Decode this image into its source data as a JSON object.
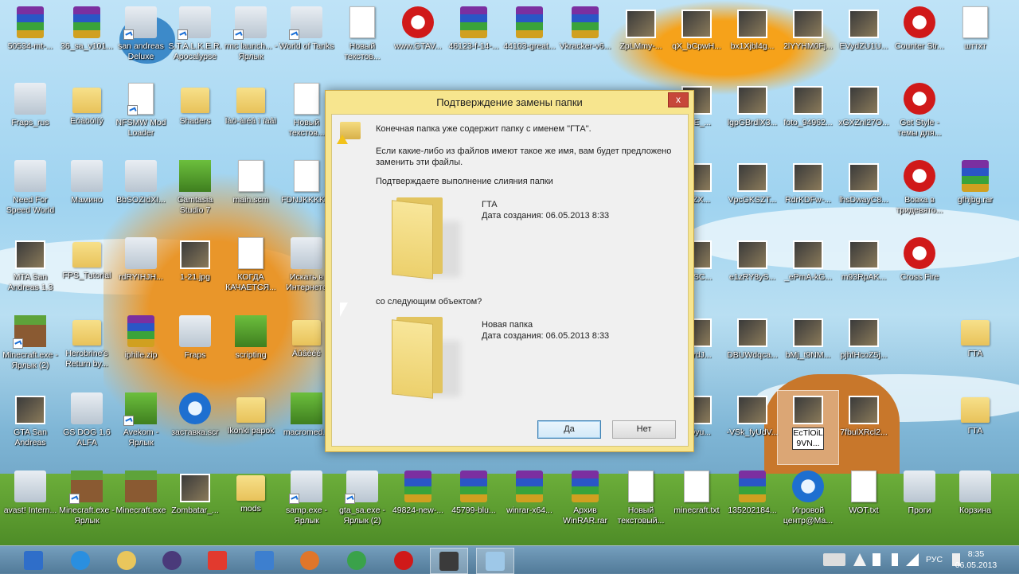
{
  "dialog": {
    "title": "Подтверждение замены папки",
    "close_label": "x",
    "line1": "Конечная папка уже содержит папку с именем \"ГТА\".",
    "line2": "Если какие-либо из файлов имеют такое же имя, вам будет предложено",
    "line3": "заменить эти файлы.",
    "question": "Подтверждаете выполнение слияния папки",
    "src_name": "ГТА",
    "src_date": "Дата создания: 06.05.2013 8:33",
    "with_label": "со следующим объектом?",
    "dst_name": "Новая папка",
    "dst_date": "Дата создания: 06.05.2013 8:33",
    "yes_label": "Да",
    "no_label": "Нет"
  },
  "desktop": {
    "icons": [
      {
        "label": "50534-mt-...",
        "kind": "rar"
      },
      {
        "label": "36_sa_v101...",
        "kind": "rar"
      },
      {
        "label": "san andreas Deluxe",
        "kind": "app"
      },
      {
        "label": "S.T.A.L.K.E.R. Apocalypse",
        "kind": "app"
      },
      {
        "label": "rmc launch... - Ярлык",
        "kind": "app"
      },
      {
        "label": "World of Tanks",
        "kind": "app"
      },
      {
        "label": "Новый текстов...",
        "kind": "doc"
      },
      {
        "label": "www.GTAV...",
        "kind": "red"
      },
      {
        "label": "46123-f-14-...",
        "kind": "rar"
      },
      {
        "label": "44103-great...",
        "kind": "rar"
      },
      {
        "label": "Vkracker-v6...",
        "kind": "rar"
      },
      {
        "label": "ZpLMmy-...",
        "kind": "photo"
      },
      {
        "label": "qX_bCpwH...",
        "kind": "photo"
      },
      {
        "label": "bx1Xjbl4g...",
        "kind": "photo"
      },
      {
        "label": "2lYYHM0Fj...",
        "kind": "photo"
      },
      {
        "label": "EVydZU1U...",
        "kind": "photo"
      },
      {
        "label": "Counter Str...",
        "kind": "red"
      },
      {
        "label": "шттхт",
        "kind": "doc"
      },
      {
        "label": "Fraps_rus",
        "kind": "app"
      },
      {
        "label": "Ëóàöóííý",
        "kind": "folder"
      },
      {
        "label": "NFSMW Mod Loader",
        "kind": "doc"
      },
      {
        "label": "Shaders",
        "kind": "folder"
      },
      {
        "label": "Ïàö-àïéâ ï ïàâì",
        "kind": "folder"
      },
      {
        "label": "Новый текстов...",
        "kind": "doc"
      },
      {
        "label": "МdE_...",
        "kind": "photo"
      },
      {
        "label": "lgpGBrdlX3...",
        "kind": "photo"
      },
      {
        "label": "foto_94962...",
        "kind": "photo"
      },
      {
        "label": "xGXZnl27O...",
        "kind": "photo"
      },
      {
        "label": "Get Style - темы для...",
        "kind": "red"
      },
      {
        "label": "Need For Speed World",
        "kind": "app"
      },
      {
        "label": "Мамино",
        "kind": "app"
      },
      {
        "label": "BbSOZIdXI...",
        "kind": "app"
      },
      {
        "label": "Camtasia Studio 7",
        "kind": "green"
      },
      {
        "label": "main.scm",
        "kind": "doc"
      },
      {
        "label": "FDNJKKKK...",
        "kind": "doc"
      },
      {
        "label": "FnZX...",
        "kind": "photo"
      },
      {
        "label": "VpcGKSZT...",
        "kind": "photo"
      },
      {
        "label": "RdrKDFw-...",
        "kind": "photo"
      },
      {
        "label": "lhsDwayC8...",
        "kind": "photo"
      },
      {
        "label": "Вовка в тридевято...",
        "kind": "red"
      },
      {
        "label": "gfhjbg.rar",
        "kind": "rar"
      },
      {
        "label": "MTA San Andreas 1.3",
        "kind": "photo"
      },
      {
        "label": "FPS_Tutorial",
        "kind": "folder"
      },
      {
        "label": "rdRYIHJH...",
        "kind": "app"
      },
      {
        "label": "1-21.jpg",
        "kind": "photo"
      },
      {
        "label": "КОГДА КАЧАЕТСЯ...",
        "kind": "doc"
      },
      {
        "label": "Искать в Интернете",
        "kind": "app"
      },
      {
        "label": "23-SC...",
        "kind": "photo"
      },
      {
        "label": "e1zRY8yS...",
        "kind": "photo"
      },
      {
        "label": "_ePmA-kG...",
        "kind": "photo"
      },
      {
        "label": "m93RpAK...",
        "kind": "photo"
      },
      {
        "label": "Cross Fire",
        "kind": "red"
      },
      {
        "label": "Minecraft.exe - Ярлык (2)",
        "kind": "mine"
      },
      {
        "label": "Herobrine's Return by...",
        "kind": "folder"
      },
      {
        "label": "iphile.zip",
        "kind": "rar"
      },
      {
        "label": "Fraps",
        "kind": "app"
      },
      {
        "label": "scripting",
        "kind": "green"
      },
      {
        "label": "Áûâèéé",
        "kind": "folder"
      },
      {
        "label": "BArdJ...",
        "kind": "photo"
      },
      {
        "label": "DBUWdqca...",
        "kind": "photo"
      },
      {
        "label": "bMj_t9NM...",
        "kind": "photo"
      },
      {
        "label": "pjhfHcoZ5j...",
        "kind": "photo"
      },
      {
        "label": "ГТА",
        "kind": "folder"
      },
      {
        "label": "GTA San Andreas",
        "kind": "photo"
      },
      {
        "label": "GS DOG 1.6 ALFA",
        "kind": "app"
      },
      {
        "label": "Avekom - Ярлык",
        "kind": "green"
      },
      {
        "label": "заставка.scr",
        "kind": "blue"
      },
      {
        "label": "Ikonki papok",
        "kind": "folder"
      },
      {
        "label": "macromed...",
        "kind": "green"
      },
      {
        "label": "OOyu...",
        "kind": "photo"
      },
      {
        "label": "-VSk_fyUdV...",
        "kind": "photo"
      },
      {
        "label": "EcTlOiL9VN...",
        "kind": "photo"
      },
      {
        "label": "7fbulXRcl2...",
        "kind": "photo"
      },
      {
        "label": "ГТА",
        "kind": "folder"
      },
      {
        "label": "avast! Intern...",
        "kind": "app"
      },
      {
        "label": "Minecraft.exe - Ярлык",
        "kind": "mine"
      },
      {
        "label": "Minecraft.exe",
        "kind": "mine"
      },
      {
        "label": "Zombatar_...",
        "kind": "photo"
      },
      {
        "label": "mods",
        "kind": "folder"
      },
      {
        "label": "samp.exe - Ярлык",
        "kind": "app"
      },
      {
        "label": "gta_sa.exe - Ярлык (2)",
        "kind": "app"
      },
      {
        "label": "49824-new-...",
        "kind": "rar"
      },
      {
        "label": "45799-blu...",
        "kind": "rar"
      },
      {
        "label": "winrar-x64...",
        "kind": "rar"
      },
      {
        "label": "Архив WinRAR.rar",
        "kind": "rar"
      },
      {
        "label": "Новый текстовый...",
        "kind": "doc"
      },
      {
        "label": "minecraft.txt",
        "kind": "doc"
      },
      {
        "label": "135202184...",
        "kind": "rar"
      },
      {
        "label": "Игровой центр@Ма...",
        "kind": "blue"
      },
      {
        "label": "WOT.txt",
        "kind": "doc"
      },
      {
        "label": "Проги",
        "kind": "app"
      },
      {
        "label": "Корзина",
        "kind": "app"
      }
    ]
  },
  "taskbar": {
    "items": [
      {
        "name": "help-icon",
        "color": "#2f6ec9"
      },
      {
        "name": "internet-explorer-icon",
        "color": "#2a8fe0"
      },
      {
        "name": "explorer-icon",
        "color": "#e9c65c"
      },
      {
        "name": "media-center-icon",
        "color": "#4a3a7a"
      },
      {
        "name": "yandex-browser-icon",
        "color": "#e23a2e"
      },
      {
        "name": "volume-mixer-icon",
        "color": "#3d7fcf"
      },
      {
        "name": "firefox-icon",
        "color": "#e0762a"
      },
      {
        "name": "chrome-icon",
        "color": "#3aa24a"
      },
      {
        "name": "opera-icon",
        "color": "#d01919"
      },
      {
        "name": "camtasia-recorder-icon",
        "color": "#3b3b3b"
      },
      {
        "name": "window-icon",
        "color": "#9ec8e8"
      }
    ],
    "lang": "РУС",
    "time": "8:35",
    "date": "06.05.2013"
  }
}
